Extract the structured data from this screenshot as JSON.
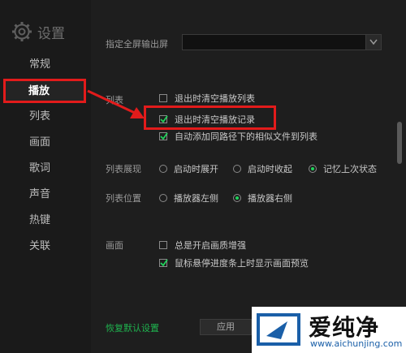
{
  "app": {
    "title": "设置"
  },
  "sidebar": {
    "items": [
      {
        "label": "常规"
      },
      {
        "label": "播放"
      },
      {
        "label": "列表"
      },
      {
        "label": "画面"
      },
      {
        "label": "歌词"
      },
      {
        "label": "声音"
      },
      {
        "label": "热键"
      },
      {
        "label": "关联"
      }
    ],
    "active_index": 1
  },
  "fullscreen": {
    "label": "指定全屏输出屏",
    "value": ""
  },
  "list_section": {
    "label": "列表",
    "options": [
      {
        "label": "退出时清空播放列表",
        "checked": false
      },
      {
        "label": "退出时清空播放记录",
        "checked": true
      },
      {
        "label": "自动添加同路径下的相似文件到列表",
        "checked": true
      }
    ]
  },
  "list_expand": {
    "label": "列表展现",
    "options": [
      {
        "label": "启动时展开",
        "selected": false
      },
      {
        "label": "启动时收起",
        "selected": false
      },
      {
        "label": "记忆上次状态",
        "selected": true
      }
    ]
  },
  "list_position": {
    "label": "列表位置",
    "options": [
      {
        "label": "播放器左侧",
        "selected": false
      },
      {
        "label": "播放器右侧",
        "selected": true
      }
    ]
  },
  "picture": {
    "label": "画面",
    "options": [
      {
        "label": "总是开启画质增强",
        "checked": false
      },
      {
        "label": "鼠标悬停进度条上时显示画面预览",
        "checked": true
      }
    ]
  },
  "footer": {
    "restore_label": "恢复默认设置",
    "apply_label": "应用"
  },
  "watermark": {
    "brand": "爱纯净",
    "url": "www.aichunjing.com"
  },
  "colors": {
    "accent": "#1fd35b",
    "highlight": "#e21b1b",
    "background": "#1e1e1e"
  }
}
